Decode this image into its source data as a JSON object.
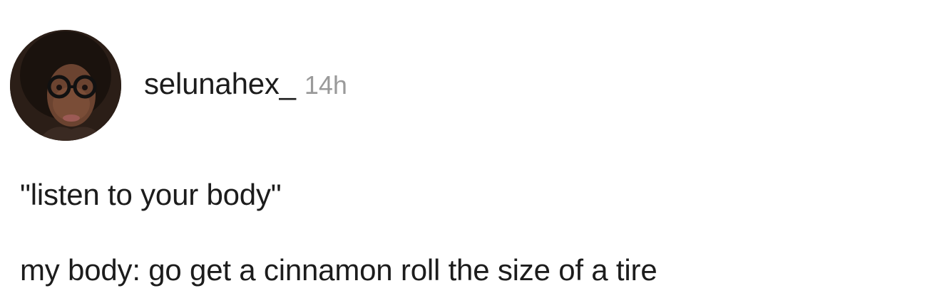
{
  "post": {
    "username": "selunahex_",
    "time": "14h",
    "lines": [
      "\"listen to your body\"",
      "my body: go get a cinnamon roll the size of a tire"
    ]
  },
  "icons": {
    "avatar": "profile-photo"
  },
  "colors": {
    "background": "#ffffff",
    "text": "#1c1c1c",
    "timestamp": "#9a9a9a"
  }
}
